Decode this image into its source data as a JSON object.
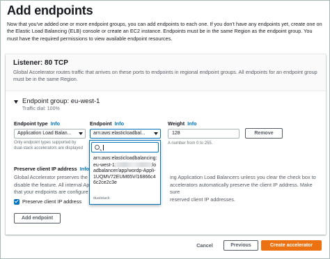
{
  "page": {
    "title": "Add endpoints",
    "intro": "Now that you've added one or more endpoint groups, you can add endpoints to each one. If you don't have any endpoints yet, create one on the Elastic Load Balancing (ELB) console or create an EC2 instance. Endpoints must be in the same Region as the endpoint group. You must have the required permissions to view available endpoint resources."
  },
  "listener": {
    "title": "Listener: 80 TCP",
    "description": "Global Accelerator routes traffic that arrives on these ports to endpoints in regional endpoint groups. All endpoints for an endpoint group must be in the same Region."
  },
  "endpoint_group": {
    "title": "Endpoint group: eu-west-1",
    "traffic_dial": "Traffic dial: 100%",
    "endpoint_type_label": "Endpoint type",
    "endpoint_type_value": "Application Load Balan...",
    "endpoint_type_help": "Only endpoint types supported by dual-stack accelerators are displayed",
    "endpoint_label": "Endpoint",
    "endpoint_value": "arn:aws:elasticloadbal...",
    "weight_label": "Weight",
    "weight_value": "128",
    "weight_help": "A number from 0 to 255.",
    "remove_label": "Remove",
    "info_label": "Info",
    "dropdown": {
      "search_value": "",
      "option_part1": "arn:aws:elasticloadbalancing:eu-west-1:",
      "option_part2": ":loadbalancer/app/wordp-Appli-1UQMV72EUM65V/16866c46c2ce2c3e",
      "option_tag": "dualstack"
    }
  },
  "preserve": {
    "label": "Preserve client IP address",
    "info_label": "Info",
    "desc_left": "Global Accelerator preserves the c... ...ing Application Load Balancers unless you clear the check box to disable the feature. All internal App... ...accelerators automatically preserve the client IP address. Make sure that your endpoints are configure... ...reserved client IP addresses.",
    "desc_line1_left": "Global Accelerator preserves the c",
    "desc_line2_left": "disable the feature. All internal Ap",
    "desc_line3_left": "that your endpoints are configure",
    "desc_line1_right": "ing Application Load Balancers unless you clear the check box to",
    "desc_line2_right": "accelerators automatically preserve the client IP address. Make sure",
    "desc_line3_right": "reserved client IP addresses.",
    "checkbox_label": "Preserve client IP address",
    "checked": true
  },
  "add_endpoint_label": "Add endpoint",
  "footer": {
    "cancel": "Cancel",
    "previous": "Previous",
    "create": "Create accelerator"
  },
  "colors": {
    "link": "#0073bb",
    "primary_button": "#ec7211",
    "text": "#16191f",
    "muted": "#687078"
  }
}
